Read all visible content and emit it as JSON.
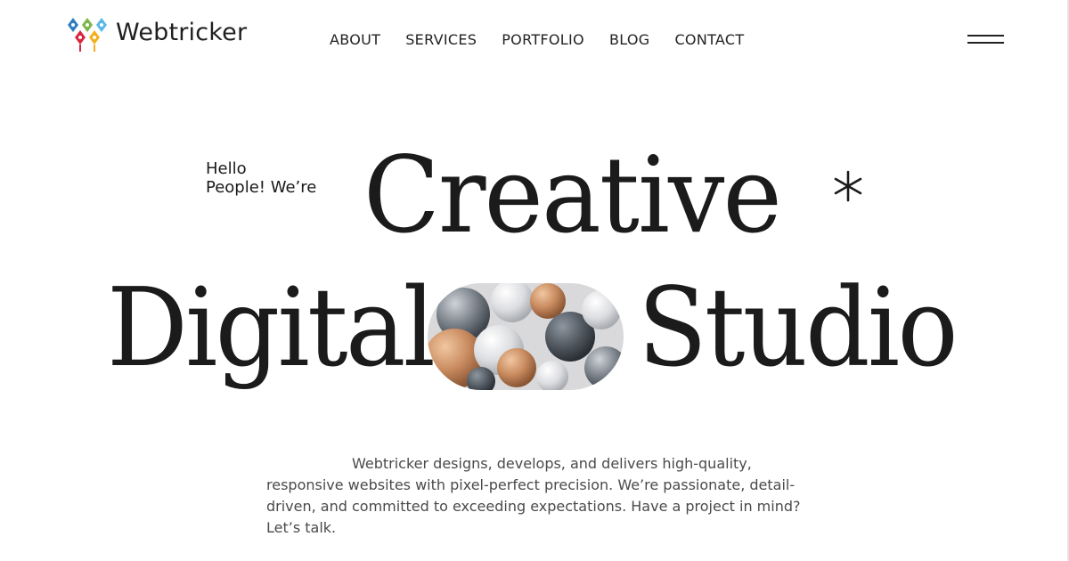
{
  "header": {
    "logo_text": "Webtricker",
    "nav": [
      "ABOUT",
      "SERVICES",
      "PORTFOLIO",
      "BLOG",
      "CONTACT"
    ],
    "menu_icon": "hamburger-menu-icon"
  },
  "hero": {
    "greeting_line1": "Hello",
    "greeting_line2": "People! We’re",
    "word1": "Creative",
    "word2": "Digital",
    "word3": "Studio",
    "asterisk_icon": "asterisk-icon",
    "image_alt": "abstract 3D spheres"
  },
  "intro": {
    "text": "Webtricker designs, develops, and delivers high-quality, responsive websites with pixel-perfect precision. We’re passionate, detail-driven, and committed to exceeding expectations. Have a project in mind? Let’s talk."
  },
  "colors": {
    "text": "#1a1a1a",
    "background": "#ffffff",
    "logo_blue": "#2e7dc1",
    "logo_green": "#7ab648",
    "logo_red": "#d7263d",
    "logo_yellow": "#f2b01e",
    "logo_lightblue": "#5bb8e8"
  }
}
